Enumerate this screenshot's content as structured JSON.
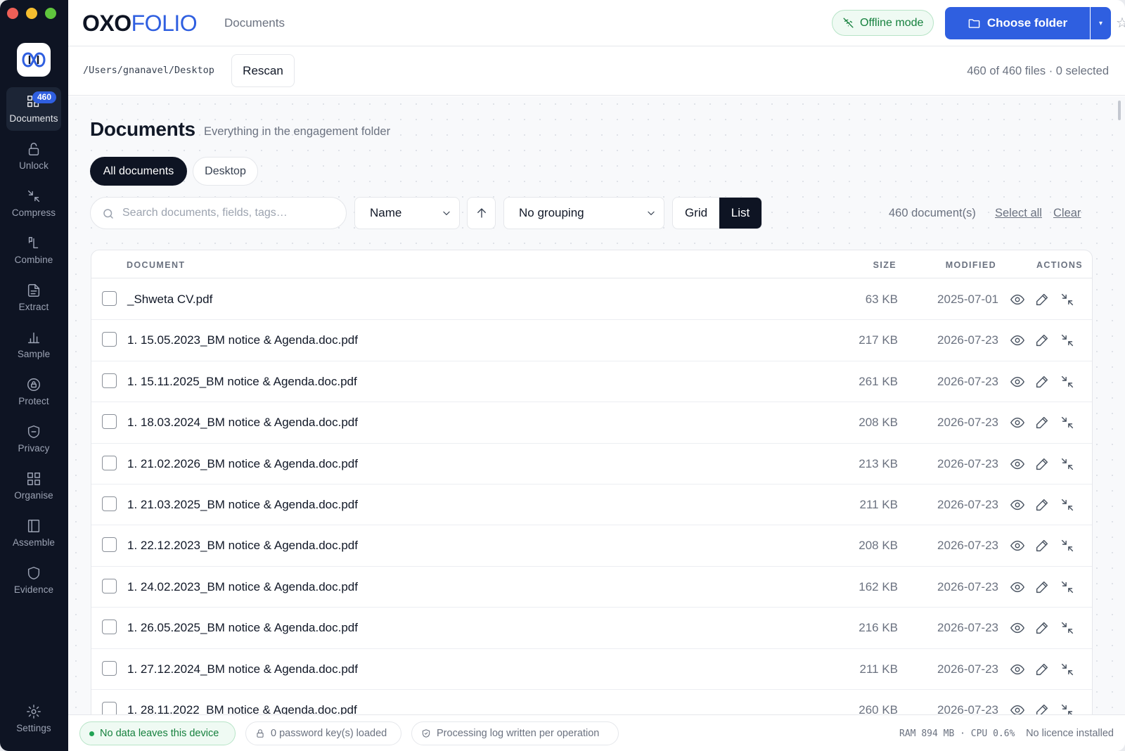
{
  "brand": {
    "part1": "OXO",
    "part2": "FOLIO",
    "section": "Documents"
  },
  "topbar": {
    "offline_label": "Offline mode",
    "choose_folder_label": "Choose folder",
    "caret": "▾",
    "star": "☆"
  },
  "sidebar": {
    "documents_badge": "460",
    "items": [
      {
        "label": "Documents",
        "icon": "grid-icon",
        "active": true
      },
      {
        "label": "Unlock",
        "icon": "unlock-icon"
      },
      {
        "label": "Compress",
        "icon": "compress-icon"
      },
      {
        "label": "Combine",
        "icon": "combine-icon"
      },
      {
        "label": "Extract",
        "icon": "extract-icon"
      },
      {
        "label": "Sample",
        "icon": "bar-chart-icon"
      },
      {
        "label": "Protect",
        "icon": "lock-badge-icon"
      },
      {
        "label": "Privacy",
        "icon": "shield-icon"
      },
      {
        "label": "Organise",
        "icon": "tiles-icon"
      },
      {
        "label": "Assemble",
        "icon": "book-icon"
      },
      {
        "label": "Evidence",
        "icon": "shield-outline-icon"
      }
    ],
    "settings_label": "Settings"
  },
  "pathbar": {
    "path": "/Users/gnanavel/Desktop",
    "rescan_label": "Rescan",
    "files_count": "460 of 460 files · 0 selected"
  },
  "main": {
    "title": "Documents",
    "subtitle": "Everything in the engagement folder",
    "chips": [
      "All documents",
      "Desktop"
    ],
    "search_placeholder": "Search documents, fields, tags…",
    "sort_value": "Name",
    "grouping_value": "No grouping",
    "view_grid": "Grid",
    "view_list": "List",
    "doc_count": "460 document(s)",
    "select_all": "Select all",
    "clear": "Clear"
  },
  "table": {
    "headers": {
      "document": "DOCUMENT",
      "size": "SIZE",
      "modified": "MODIFIED",
      "actions": "ACTIONS"
    },
    "rows": [
      {
        "name": "_Shweta CV.pdf",
        "size": "63 KB",
        "modified": "2025-07-01"
      },
      {
        "name": "1. 15.05.2023_BM notice & Agenda.doc.pdf",
        "size": "217 KB",
        "modified": "2026-07-23"
      },
      {
        "name": "1. 15.11.2025_BM notice & Agenda.doc.pdf",
        "size": "261 KB",
        "modified": "2026-07-23"
      },
      {
        "name": "1. 18.03.2024_BM notice & Agenda.doc.pdf",
        "size": "208 KB",
        "modified": "2026-07-23"
      },
      {
        "name": "1. 21.02.2026_BM notice & Agenda.doc.pdf",
        "size": "213 KB",
        "modified": "2026-07-23"
      },
      {
        "name": "1. 21.03.2025_BM notice & Agenda.doc.pdf",
        "size": "211 KB",
        "modified": "2026-07-23"
      },
      {
        "name": "1. 22.12.2023_BM notice & Agenda.doc.pdf",
        "size": "208 KB",
        "modified": "2026-07-23"
      },
      {
        "name": "1. 24.02.2023_BM notice & Agenda.doc.pdf",
        "size": "162 KB",
        "modified": "2026-07-23"
      },
      {
        "name": "1. 26.05.2025_BM notice & Agenda.doc.pdf",
        "size": "216 KB",
        "modified": "2026-07-23"
      },
      {
        "name": "1. 27.12.2024_BM notice & Agenda.doc.pdf",
        "size": "211 KB",
        "modified": "2026-07-23"
      },
      {
        "name": "1. 28.11.2022_BM notice & Agenda.doc.pdf",
        "size": "260 KB",
        "modified": "2026-07-23"
      }
    ]
  },
  "footer": {
    "privacy": "No data leaves this device",
    "keys": "0 password key(s) loaded",
    "log": "Processing log written per operation",
    "stats": "RAM 894 MB · CPU 0.6%",
    "licence": "No licence installed"
  },
  "colors": {
    "accent": "#2f5fe0",
    "sidebar": "#0e1423",
    "success": "#15803d"
  }
}
